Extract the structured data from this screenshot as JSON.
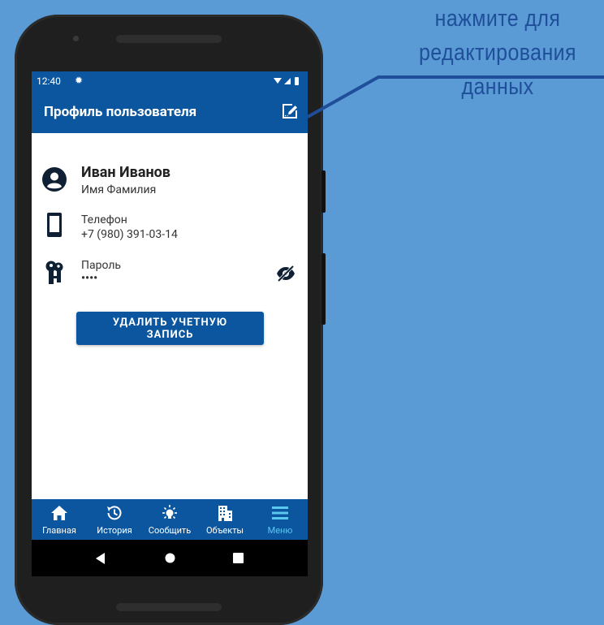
{
  "callout": {
    "line1": "нажмите для",
    "line2": "редактирования",
    "line3": "данных"
  },
  "status_bar": {
    "time": "12:40"
  },
  "app_bar": {
    "title": "Профиль пользователя",
    "edit_icon": "edit-profile-icon"
  },
  "profile": {
    "name": "Иван Иванов",
    "name_caption": "Имя Фамилия",
    "phone_label": "Телефон",
    "phone_value": "+7 (980) 391-03-14",
    "password_label": "Пароль",
    "password_value": "••••"
  },
  "delete_button": {
    "line1": "УДАЛИТЬ УЧЕТНУЮ",
    "line2": "ЗАПИСЬ"
  },
  "bottom_nav": {
    "items": [
      {
        "label": "Главная",
        "icon": "home-icon"
      },
      {
        "label": "История",
        "icon": "history-icon"
      },
      {
        "label": "Сообщить",
        "icon": "lightbulb-icon"
      },
      {
        "label": "Объекты",
        "icon": "building-icon"
      },
      {
        "label": "Меню",
        "icon": "menu-icon"
      }
    ],
    "active_index": 4
  },
  "colors": {
    "brand": "#0b569e",
    "active_nav": "#5bc8f0",
    "background": "#5b9bd5",
    "callout_text": "#1f4e9a"
  }
}
